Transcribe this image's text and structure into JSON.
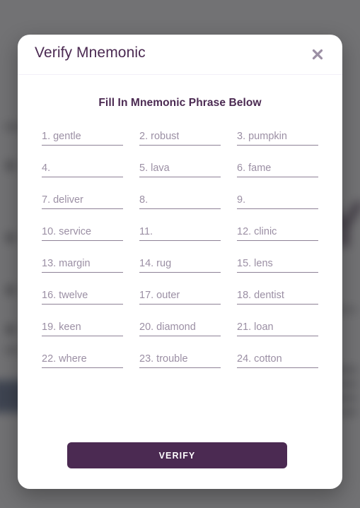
{
  "modal": {
    "title": "Verify Mnemonic",
    "close_icon": "close-x-icon",
    "subtitle": "Fill In Mnemonic Phrase Below",
    "verify_label": "VERIFY",
    "accent_color": "#4b2a52",
    "word_text_color": "#9b8fa4",
    "underline_color": "#8e8196",
    "background_color": "#ffffff"
  },
  "overlay": {
    "color": "#3c3c3e",
    "opacity": "0.72"
  },
  "backdrop": {
    "big_letter": "Y",
    "big_letter_color": "#3a2340",
    "block_color": "#27406e"
  },
  "mnemonic": {
    "count": 24,
    "slots": [
      {
        "index": "1.",
        "word": "gentle",
        "filled": true
      },
      {
        "index": "2.",
        "word": "robust",
        "filled": true
      },
      {
        "index": "3.",
        "word": "pumpkin",
        "filled": true
      },
      {
        "index": "4.",
        "word": "",
        "filled": false
      },
      {
        "index": "5.",
        "word": "lava",
        "filled": true
      },
      {
        "index": "6.",
        "word": "fame",
        "filled": true
      },
      {
        "index": "7.",
        "word": "deliver",
        "filled": true
      },
      {
        "index": "8.",
        "word": "",
        "filled": false
      },
      {
        "index": "9.",
        "word": "",
        "filled": false
      },
      {
        "index": "10.",
        "word": "service",
        "filled": true
      },
      {
        "index": "11.",
        "word": "",
        "filled": false
      },
      {
        "index": "12.",
        "word": "clinic",
        "filled": true
      },
      {
        "index": "13.",
        "word": "margin",
        "filled": true
      },
      {
        "index": "14.",
        "word": "rug",
        "filled": true
      },
      {
        "index": "15.",
        "word": "lens",
        "filled": true
      },
      {
        "index": "16.",
        "word": "twelve",
        "filled": true
      },
      {
        "index": "17.",
        "word": "outer",
        "filled": true
      },
      {
        "index": "18.",
        "word": "dentist",
        "filled": true
      },
      {
        "index": "19.",
        "word": "keen",
        "filled": true
      },
      {
        "index": "20.",
        "word": "diamond",
        "filled": true
      },
      {
        "index": "21.",
        "word": "loan",
        "filled": true
      },
      {
        "index": "22.",
        "word": "where",
        "filled": true
      },
      {
        "index": "23.",
        "word": "trouble",
        "filled": true
      },
      {
        "index": "24.",
        "word": "cotton",
        "filled": true
      }
    ]
  }
}
